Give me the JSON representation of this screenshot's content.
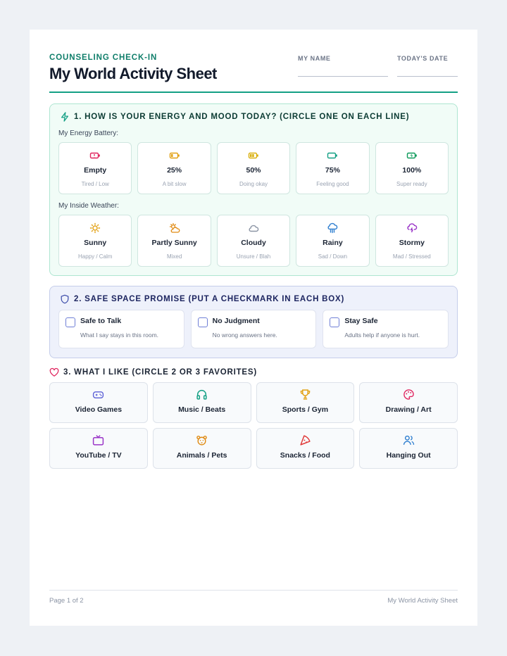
{
  "header": {
    "eyebrow": "COUNSELING CHECK-IN",
    "title": "My World Activity Sheet",
    "name_label": "MY NAME",
    "date_label": "TODAY'S DATE",
    "accent": "#14a085"
  },
  "section1": {
    "title": "1. HOW IS YOUR ENERGY AND MOOD TODAY? (CIRCLE ONE ON EACH LINE)",
    "energy_label": "My Energy Battery:",
    "energy": [
      {
        "name": "Empty",
        "desc": "Tired / Low",
        "icon": "battery-empty-icon",
        "color": "#e0245e"
      },
      {
        "name": "25%",
        "desc": "A bit slow",
        "icon": "battery-low-icon",
        "color": "#e2a012"
      },
      {
        "name": "50%",
        "desc": "Doing okay",
        "icon": "battery-half-icon",
        "color": "#d9b00f"
      },
      {
        "name": "75%",
        "desc": "Feeling good",
        "icon": "battery-high-icon",
        "color": "#14a085"
      },
      {
        "name": "100%",
        "desc": "Super ready",
        "icon": "battery-charging-icon",
        "color": "#0e9a5b"
      }
    ],
    "weather_label": "My Inside Weather:",
    "weather": [
      {
        "name": "Sunny",
        "desc": "Happy / Calm",
        "icon": "sun-icon",
        "color": "#e2a012"
      },
      {
        "name": "Partly Sunny",
        "desc": "Mixed",
        "icon": "cloud-sun-icon",
        "color": "#e08a12"
      },
      {
        "name": "Cloudy",
        "desc": "Unsure / Blah",
        "icon": "cloud-icon",
        "color": "#8c95a5"
      },
      {
        "name": "Rainy",
        "desc": "Sad / Down",
        "icon": "cloud-rain-icon",
        "color": "#2f7fd0"
      },
      {
        "name": "Stormy",
        "desc": "Mad / Stressed",
        "icon": "cloud-lightning-icon",
        "color": "#9a35c8"
      }
    ]
  },
  "section2": {
    "title": "2. SAFE SPACE PROMISE (PUT A CHECKMARK IN EACH BOX)",
    "items": [
      {
        "title": "Safe to Talk",
        "desc": "What I say stays in this room."
      },
      {
        "title": "No Judgment",
        "desc": "No wrong answers here."
      },
      {
        "title": "Stay Safe",
        "desc": "Adults help if anyone is hurt."
      }
    ]
  },
  "section3": {
    "title": "3. WHAT I LIKE (CIRCLE 2 OR 3 FAVORITES)",
    "likes": [
      {
        "label": "Video Games",
        "icon": "gamepad-icon",
        "color": "#5b5fd6"
      },
      {
        "label": "Music / Beats",
        "icon": "headphones-icon",
        "color": "#14a085"
      },
      {
        "label": "Sports / Gym",
        "icon": "trophy-icon",
        "color": "#e2a012"
      },
      {
        "label": "Drawing / Art",
        "icon": "palette-icon",
        "color": "#e0245e"
      },
      {
        "label": "YouTube / TV",
        "icon": "tv-icon",
        "color": "#9a35c8"
      },
      {
        "label": "Animals / Pets",
        "icon": "paw-icon",
        "color": "#e08a12"
      },
      {
        "label": "Snacks / Food",
        "icon": "pizza-icon",
        "color": "#e03a3a"
      },
      {
        "label": "Hanging Out",
        "icon": "users-icon",
        "color": "#2f7fd0"
      }
    ]
  },
  "footer": {
    "page": "Page 1 of 2",
    "doc_title": "My World Activity Sheet"
  }
}
